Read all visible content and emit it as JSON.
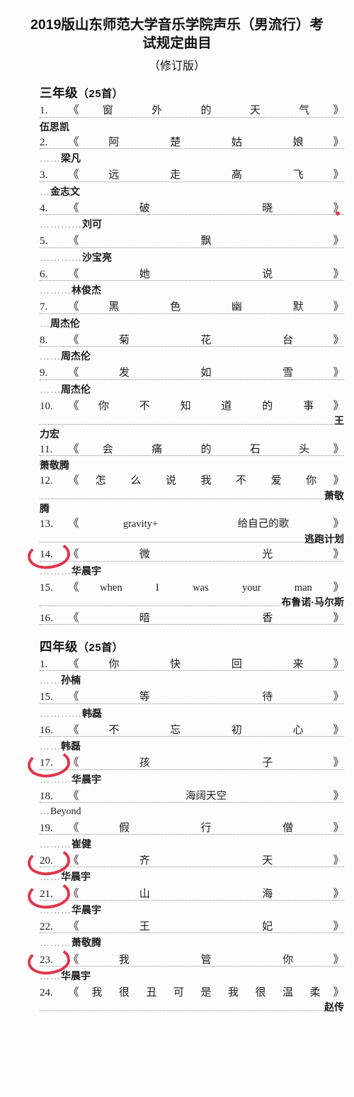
{
  "document": {
    "title": "2019版山东师范大学音乐学院声乐（男流行）考试规定曲目",
    "subtitle": "（修订版）"
  },
  "annotation_color": "#e0243b",
  "sections": [
    {
      "heading": "三年级",
      "count": "（25首）",
      "entries": [
        {
          "num": "1.",
          "title": "窗外的天气",
          "artist": "伍思凯",
          "artist_tail": "",
          "artist_lead": "",
          "circled": false,
          "latin": false
        },
        {
          "num": "2.",
          "title": "阿楚姑娘",
          "artist": "梁凡",
          "artist_tail": "",
          "artist_lead": "……",
          "circled": false,
          "latin": false
        },
        {
          "num": "3.",
          "title": "远走高飞",
          "artist": "金志文",
          "artist_tail": "",
          "artist_lead": "…",
          "circled": false,
          "latin": false
        },
        {
          "num": "4.",
          "title": "破晓",
          "artist": "刘可",
          "artist_tail": "",
          "artist_lead": "…………",
          "circled": false,
          "latin": false
        },
        {
          "num": "5.",
          "title": "飘",
          "artist": "沙宝亮",
          "artist_tail": "",
          "artist_lead": "…………",
          "circled": false,
          "latin": false
        },
        {
          "num": "6.",
          "title": "她说",
          "artist": "林俊杰",
          "artist_tail": "",
          "artist_lead": "………",
          "circled": false,
          "latin": false
        },
        {
          "num": "7.",
          "title": "黑色幽默",
          "artist": "周杰伦",
          "artist_tail": "",
          "artist_lead": "…",
          "circled": false,
          "latin": false
        },
        {
          "num": "8.",
          "title": "菊花台",
          "artist": "周杰伦",
          "artist_tail": "",
          "artist_lead": "……",
          "circled": false,
          "latin": false
        },
        {
          "num": "9.",
          "title": "发如雪",
          "artist": "周杰伦",
          "artist_tail": "",
          "artist_lead": "……",
          "circled": false,
          "latin": false
        },
        {
          "num": "10.",
          "title": "你不知道的事",
          "artist": "力宏",
          "artist_tail": "王",
          "artist_lead": "",
          "circled": false,
          "latin": false
        },
        {
          "num": "11.",
          "title": "会痛的石头",
          "artist": "萧敬腾",
          "artist_tail": "",
          "artist_lead": "",
          "circled": false,
          "latin": false
        },
        {
          "num": "12.",
          "title": "怎么说我不爱你",
          "artist": "腾",
          "artist_tail": "萧敬",
          "artist_lead": "",
          "circled": false,
          "latin": false
        },
        {
          "num": "13.",
          "title": "gravity+给自己的歌",
          "artist": "",
          "artist_tail": "逃跑计划",
          "artist_lead": "",
          "circled": false,
          "latin": true
        },
        {
          "num": "14.",
          "title": "微光",
          "artist": "华晨宇",
          "artist_tail": "",
          "artist_lead": "………",
          "circled": true,
          "latin": false
        },
        {
          "num": "15.",
          "title": "when I was your man",
          "artist": "",
          "artist_tail": "布鲁诺·马尔斯",
          "artist_lead": "",
          "circled": false,
          "latin": true
        },
        {
          "num": "16.",
          "title": "暗香",
          "artist": "",
          "artist_tail": "",
          "artist_lead": "",
          "circled": false,
          "latin": false
        }
      ]
    },
    {
      "heading": "四年级",
      "count": "（25首）",
      "entries": [
        {
          "num": "1.",
          "title": "你快回来",
          "artist": "孙楠",
          "artist_tail": "",
          "artist_lead": "……",
          "circled": false,
          "latin": false
        },
        {
          "num": "15.",
          "title": "等待",
          "artist": "韩磊",
          "artist_tail": "",
          "artist_lead": "…………",
          "circled": false,
          "latin": false
        },
        {
          "num": "16.",
          "title": "不忘初心",
          "artist": "韩磊",
          "artist_tail": "",
          "artist_lead": "……",
          "circled": false,
          "latin": false
        },
        {
          "num": "17.",
          "title": "孩子",
          "artist": "华晨宇",
          "artist_tail": "",
          "artist_lead": "………",
          "circled": true,
          "latin": false
        },
        {
          "num": "18.",
          "title": "海阔天空",
          "artist": "Beyond",
          "artist_tail": "",
          "artist_lead": "…",
          "circled": false,
          "latin": true
        },
        {
          "num": "19.",
          "title": "假行僧",
          "artist": "崔健",
          "artist_tail": "",
          "artist_lead": "………",
          "circled": false,
          "latin": false
        },
        {
          "num": "20.",
          "title": "齐天",
          "artist": "华晨宇",
          "artist_tail": "",
          "artist_lead": "……",
          "circled": true,
          "latin": false
        },
        {
          "num": "21.",
          "title": "山海",
          "artist": "华晨宇",
          "artist_tail": "",
          "artist_lead": "………",
          "circled": true,
          "latin": false
        },
        {
          "num": "22.",
          "title": "王妃",
          "artist": "萧敬腾",
          "artist_tail": "",
          "artist_lead": "………",
          "circled": false,
          "latin": false
        },
        {
          "num": "23.",
          "title": "我管你",
          "artist": "华晨宇",
          "artist_tail": "",
          "artist_lead": "……",
          "circled": true,
          "latin": false
        },
        {
          "num": "24.",
          "title": "我很丑可是我很温柔",
          "artist": "",
          "artist_tail": "赵传",
          "artist_lead": "",
          "circled": false,
          "latin": false
        }
      ]
    }
  ]
}
